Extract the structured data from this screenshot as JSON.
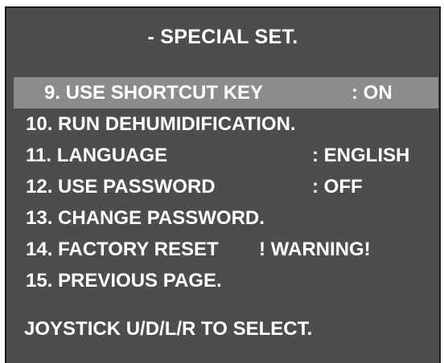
{
  "title": "- SPECIAL SET.",
  "menu": {
    "items": [
      {
        "label": "9. USE SHORTCUT KEY",
        "value": ": ON",
        "selected": true
      },
      {
        "label": "10. RUN DEHUMIDIFICATION.",
        "value": ""
      },
      {
        "label": "11. LANGUAGE",
        "value": ": ENGLISH"
      },
      {
        "label": "12. USE PASSWORD",
        "value": ": OFF"
      },
      {
        "label": "13. CHANGE PASSWORD.",
        "value": ""
      },
      {
        "label": "14. FACTORY RESET",
        "value": "! WARNING!"
      },
      {
        "label": "15. PREVIOUS PAGE.",
        "value": ""
      }
    ]
  },
  "footer": "JOYSTICK U/D/L/R TO SELECT.",
  "colors": {
    "background": "#4d4d4d",
    "highlight": "#8c8c8c",
    "text": "#ffffff"
  }
}
